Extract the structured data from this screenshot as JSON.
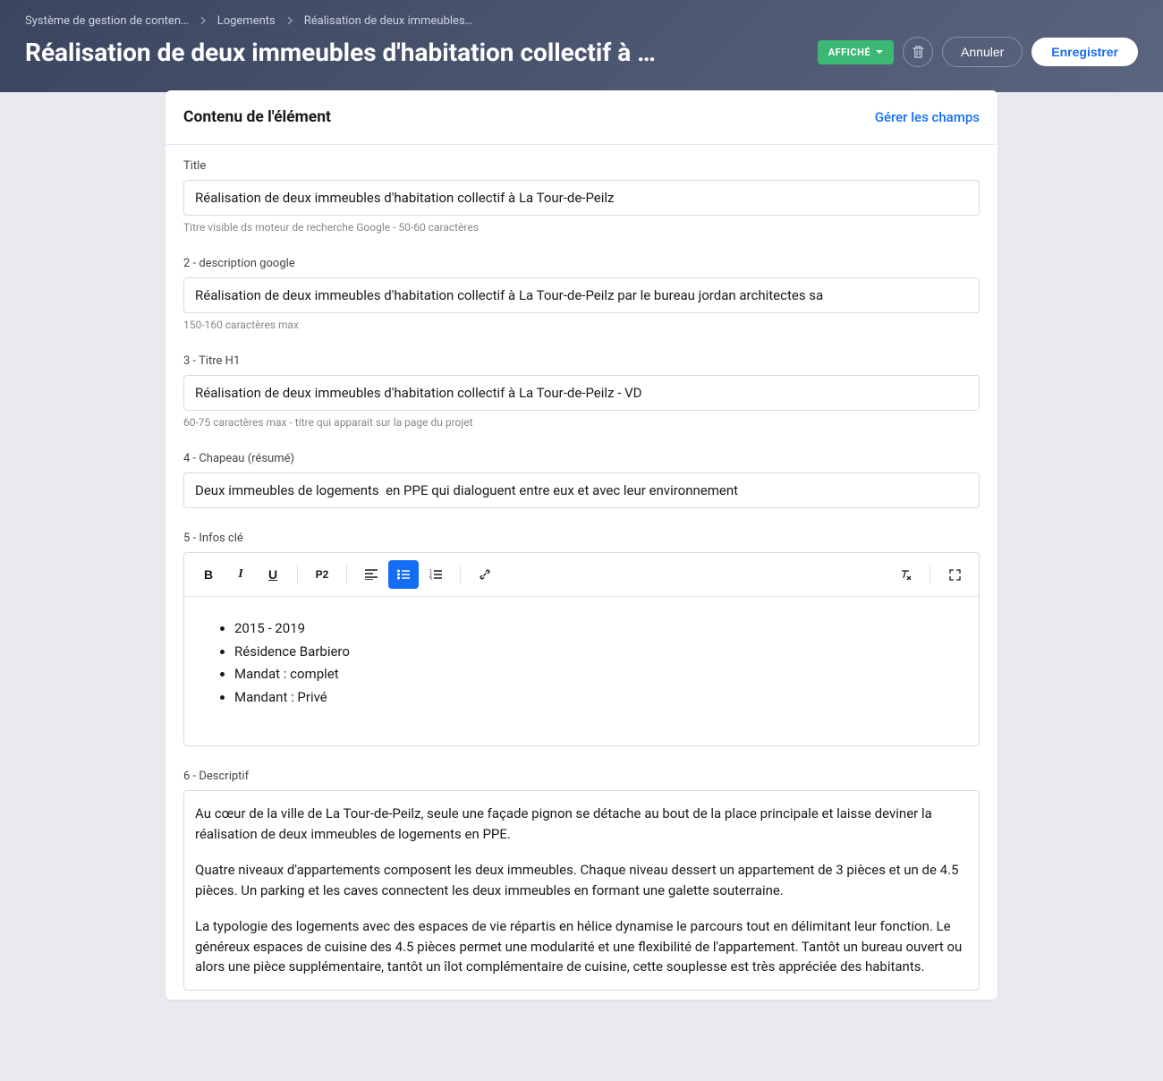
{
  "breadcrumb": {
    "item1": "Système de gestion de conten…",
    "item2": "Logements",
    "item3": "Réalisation de deux immeubles…"
  },
  "pageTitle": "Réalisation de deux immeubles d'habitation collectif à La T…",
  "status": {
    "label": "AFFICHÉ"
  },
  "buttons": {
    "cancel": "Annuler",
    "save": "Enregistrer"
  },
  "card": {
    "title": "Contenu de l'élément",
    "manageLink": "Gérer les champs"
  },
  "fields": {
    "title": {
      "label": "Title",
      "value": "Réalisation de deux immeubles d'habitation collectif à La Tour-de-Peilz",
      "helper": "Titre visible ds moteur de recherche Google - 50-60 caractères"
    },
    "desc": {
      "label": "2 - description google",
      "value": "Réalisation de deux immeubles d'habitation collectif à La Tour-de-Peilz par le bureau jordan architectes sa",
      "helper": "150-160 caractères max"
    },
    "h1": {
      "label": "3 - Titre H1",
      "value": "Réalisation de deux immeubles d'habitation collectif à La Tour-de-Peilz - VD",
      "helper": "60-75 caractères max - titre qui apparait sur la page du projet"
    },
    "chapeau": {
      "label": "4 - Chapeau (résumé)",
      "value": "Deux immeubles de logements  en PPE qui dialoguent entre eux et avec leur environnement"
    },
    "infos": {
      "label": "5 - Infos clé",
      "items": [
        "2015 - 2019",
        "Résidence Barbiero",
        "Mandat : complet",
        "Mandant : Privé"
      ]
    },
    "descriptif": {
      "label": "6 - Descriptif",
      "p1": "Au cœur de la ville de La Tour-de-Peilz, seule une façade pignon se détache au bout de la place principale et laisse deviner la réalisation de deux immeubles de logements en PPE.",
      "p2": "Quatre niveaux d'appartements composent les deux immeubles. Chaque niveau dessert un appartement de 3 pièces et un de 4.5 pièces. Un parking et les caves connectent les deux immeubles en formant une galette souterraine.",
      "p3": "La typologie des logements avec des espaces de vie répartis en hélice dynamise le parcours tout en délimitant leur fonction. Le généreux espaces de cuisine des 4.5 pièces permet une modularité et une flexibilité de l'appartement. Tantôt un bureau ouvert ou alors une pièce supplémentaire, tantôt un îlot complémentaire de cuisine, cette souplesse est très appréciée des habitants."
    }
  },
  "toolbar": {
    "p2": "P2"
  }
}
